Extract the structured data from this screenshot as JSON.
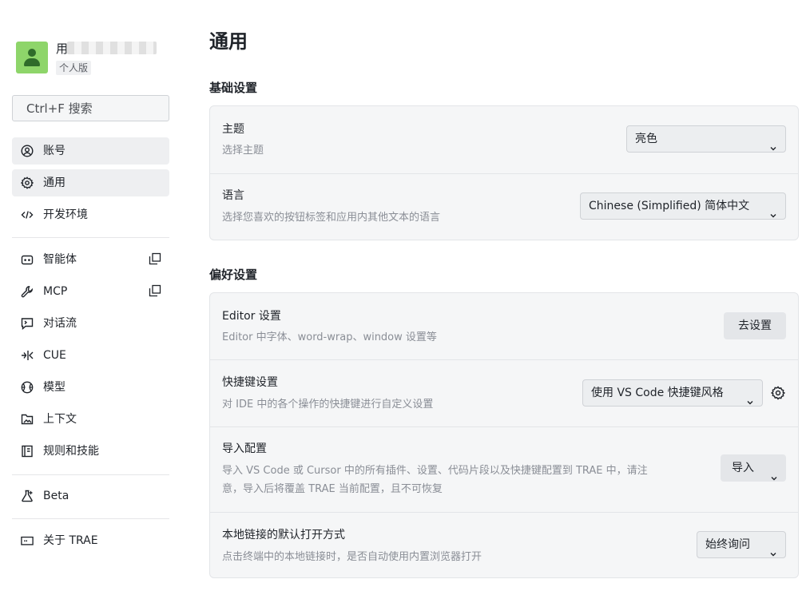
{
  "profile": {
    "name": "用",
    "plan": "个人版"
  },
  "search": {
    "placeholder": "Ctrl+F 搜索"
  },
  "nav": {
    "account": "账号",
    "general": "通用",
    "dev_env": "开发环境",
    "agents": "智能体",
    "mcp": "MCP",
    "flow": "对话流",
    "cue": "CUE",
    "models": "模型",
    "context": "上下文",
    "rules": "规则和技能",
    "beta": "Beta",
    "about": "关于 TRAE"
  },
  "page": {
    "title": "通用"
  },
  "basic": {
    "title": "基础设置",
    "theme": {
      "label": "主题",
      "desc": "选择主题",
      "value": "亮色"
    },
    "language": {
      "label": "语言",
      "desc": "选择您喜欢的按钮标签和应用内其他文本的语言",
      "value": "Chinese (Simplified) 简体中文"
    }
  },
  "prefs": {
    "title": "偏好设置",
    "editor": {
      "label": "Editor 设置",
      "desc": "Editor 中字体、word-wrap、window 设置等",
      "button": "去设置"
    },
    "keybind": {
      "label": "快捷键设置",
      "desc": "对 IDE 中的各个操作的快捷键进行自定义设置",
      "value": "使用 VS Code 快捷键风格"
    },
    "import": {
      "label": "导入配置",
      "desc_line1": "导入 VS Code 或 Cursor 中的所有插件、设置、代码片段以及快捷键配置到 TRAE 中，请注",
      "desc_line2": "意，导入后将覆盖 TRAE 当前配置，且不可恢复",
      "button": "导入"
    },
    "links": {
      "label": "本地链接的默认打开方式",
      "desc": "点击终端中的本地链接时，是否自动使用内置浏览器打开",
      "value": "始终询问"
    }
  },
  "colors": {
    "avatar_bg": "#8ed56a",
    "active_nav": "#eeeff1",
    "card_bg": "#f5f6f7"
  }
}
